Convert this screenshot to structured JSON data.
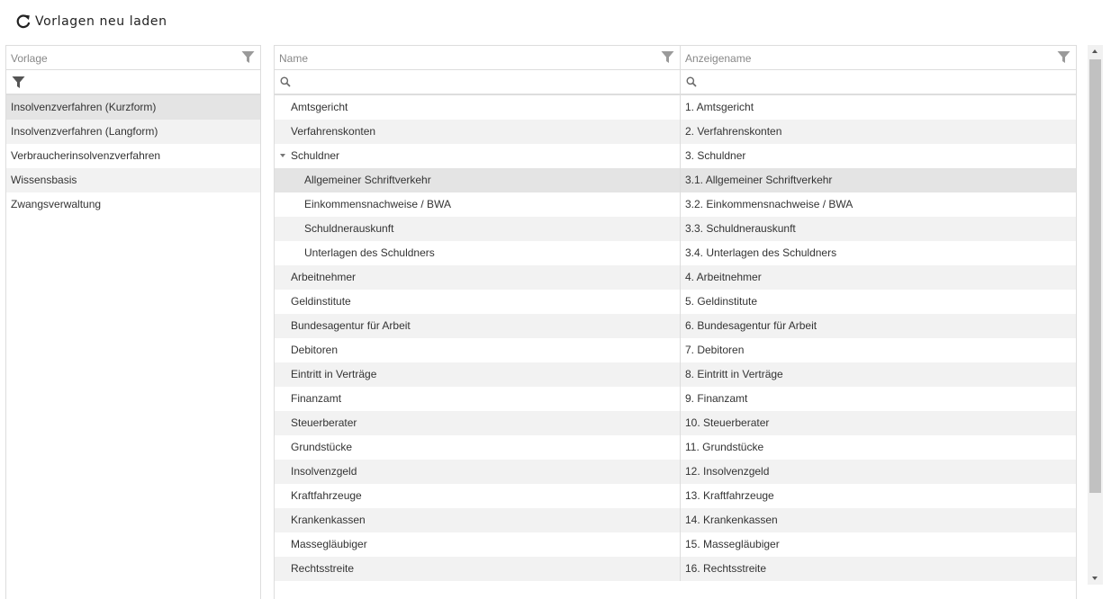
{
  "toolbar": {
    "reload_label": "Vorlagen neu laden",
    "reload_icon": "refresh-icon"
  },
  "templates_panel": {
    "header": "Vorlage",
    "items": [
      {
        "label": "Insolvenzverfahren (Kurzform)",
        "selected": true
      },
      {
        "label": "Insolvenzverfahren (Langform)"
      },
      {
        "label": "Verbraucherinsolvenzverfahren"
      },
      {
        "label": "Wissensbasis"
      },
      {
        "label": "Zwangsverwaltung"
      }
    ]
  },
  "tree_grid": {
    "columns": {
      "name": "Name",
      "display": "Anzeigename"
    },
    "rows": [
      {
        "name": "Amtsgericht",
        "display": "1. Amtsgericht",
        "level": 0
      },
      {
        "name": "Verfahrenskonten",
        "display": "2. Verfahrenskonten",
        "level": 0
      },
      {
        "name": "Schuldner",
        "display": "3. Schuldner",
        "level": 0,
        "expanded": true
      },
      {
        "name": "Allgemeiner Schriftverkehr",
        "display": "3.1. Allgemeiner Schriftverkehr",
        "level": 1,
        "selected": true
      },
      {
        "name": "Einkommensnachweise / BWA",
        "display": "3.2. Einkommensnachweise / BWA",
        "level": 1
      },
      {
        "name": "Schuldnerauskunft",
        "display": "3.3. Schuldnerauskunft",
        "level": 1
      },
      {
        "name": "Unterlagen des Schuldners",
        "display": "3.4. Unterlagen des Schuldners",
        "level": 1
      },
      {
        "name": "Arbeitnehmer",
        "display": "4. Arbeitnehmer",
        "level": 0
      },
      {
        "name": "Geldinstitute",
        "display": "5. Geldinstitute",
        "level": 0
      },
      {
        "name": "Bundesagentur für Arbeit",
        "display": "6. Bundesagentur für Arbeit",
        "level": 0
      },
      {
        "name": "Debitoren",
        "display": "7. Debitoren",
        "level": 0
      },
      {
        "name": "Eintritt in Verträge",
        "display": "8. Eintritt in Verträge",
        "level": 0
      },
      {
        "name": "Finanzamt",
        "display": "9. Finanzamt",
        "level": 0
      },
      {
        "name": "Steuerberater",
        "display": "10. Steuerberater",
        "level": 0
      },
      {
        "name": "Grundstücke",
        "display": "11. Grundstücke",
        "level": 0
      },
      {
        "name": "Insolvenzgeld",
        "display": "12. Insolvenzgeld",
        "level": 0
      },
      {
        "name": "Kraftfahrzeuge",
        "display": "13. Kraftfahrzeuge",
        "level": 0
      },
      {
        "name": "Krankenkassen",
        "display": "14. Krankenkassen",
        "level": 0
      },
      {
        "name": "Massegläubiger",
        "display": "15. Massegläubiger",
        "level": 0
      },
      {
        "name": "Rechtsstreite",
        "display": "16. Rechtsstreite",
        "level": 0
      }
    ]
  }
}
